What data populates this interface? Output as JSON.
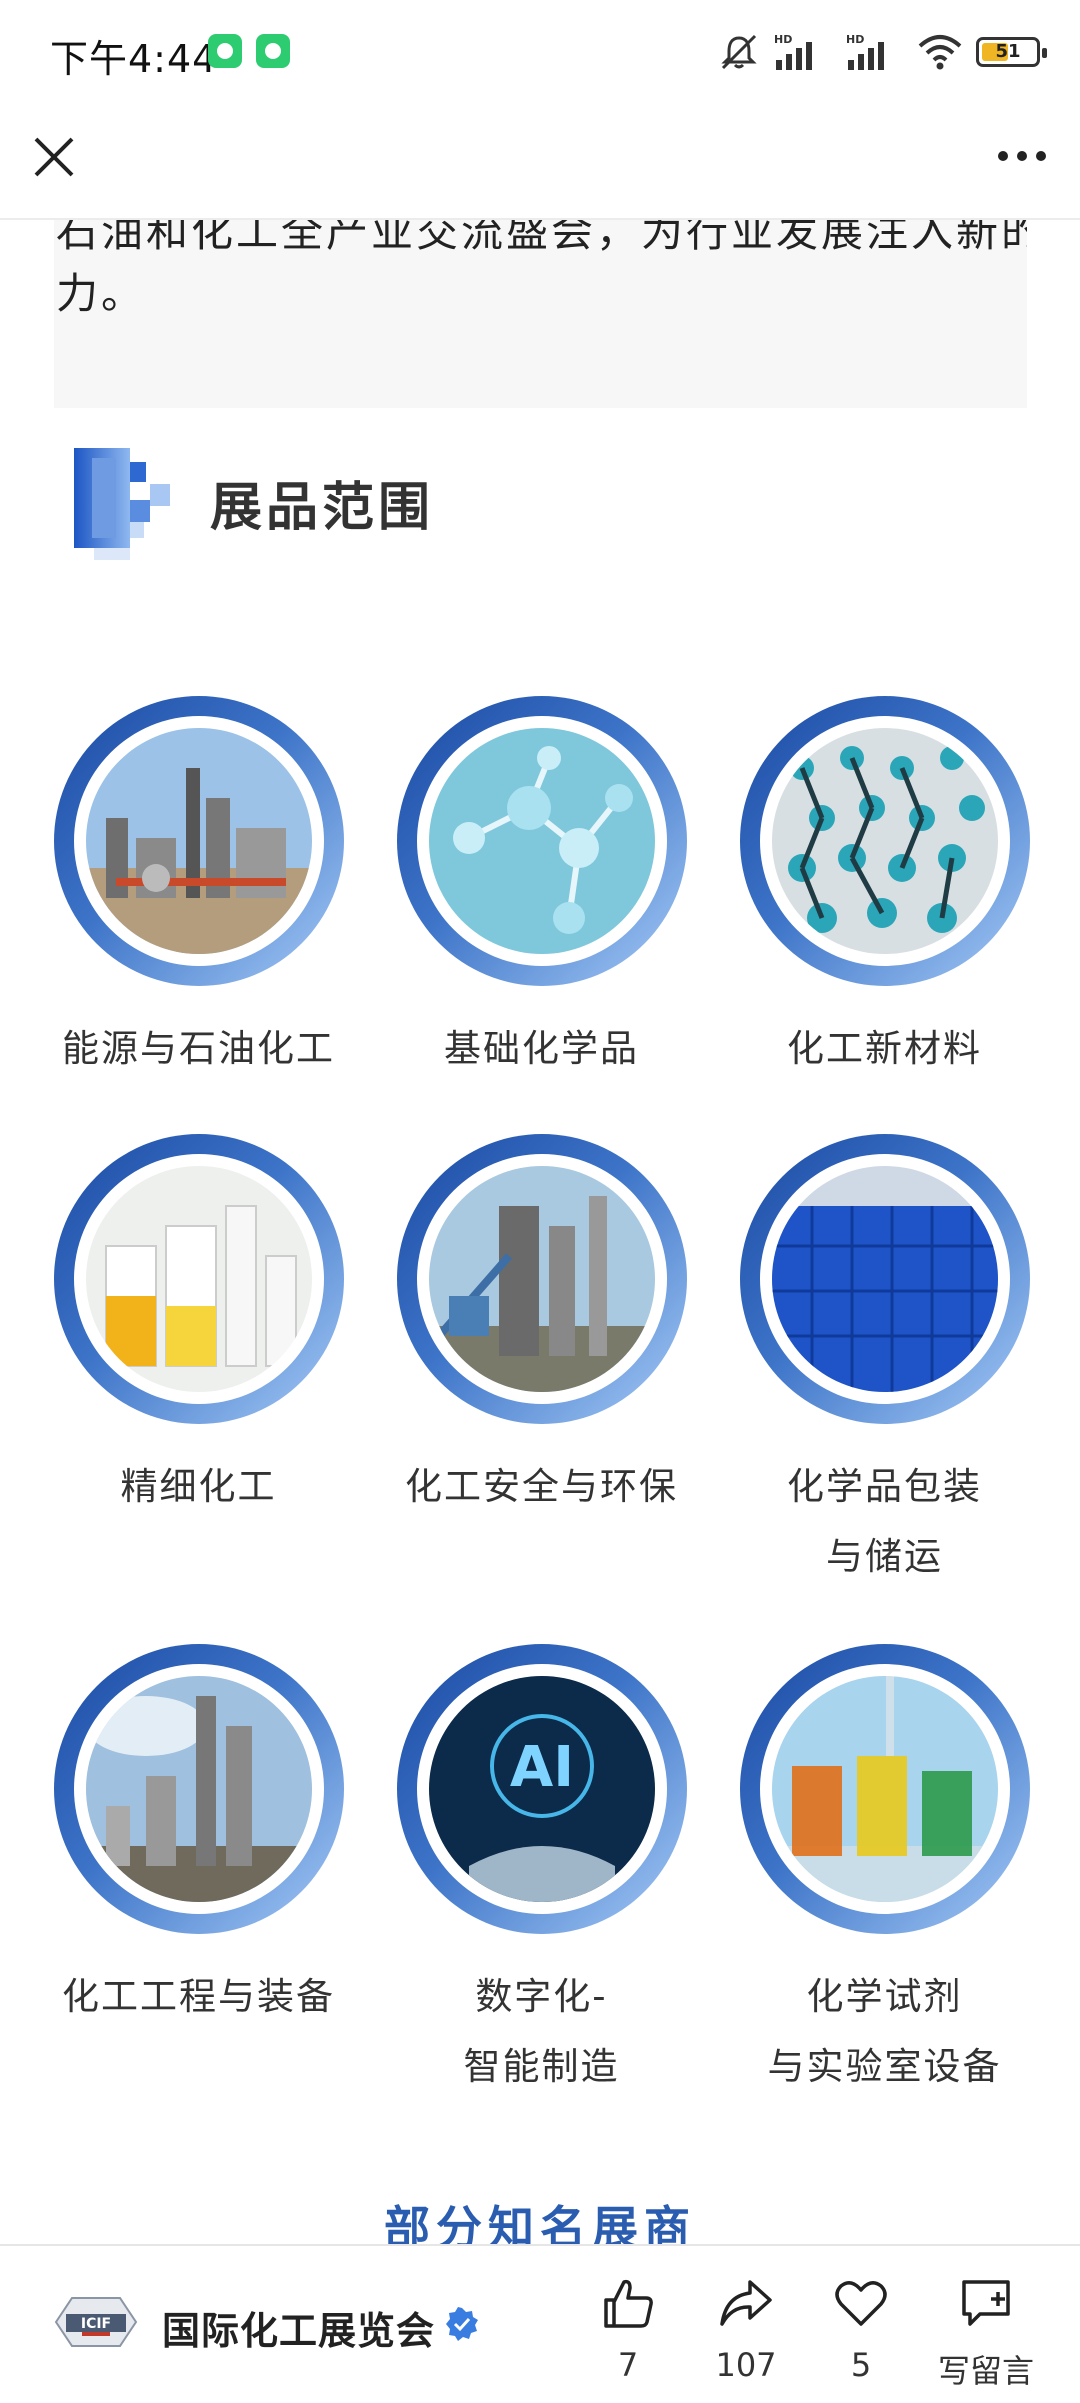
{
  "status_bar": {
    "time": "下午4:44",
    "battery": "51"
  },
  "article": {
    "quote_line1": "石油和化工全产业交流盛会，为行业发展注入新的活",
    "quote_line2": "力。",
    "section_title": "展品范围",
    "categories": [
      {
        "label": "能源与石油化工"
      },
      {
        "label": "基础化学品"
      },
      {
        "label": "化工新材料"
      },
      {
        "label": "精细化工"
      },
      {
        "label": "化工安全与环保"
      },
      {
        "label": "化学品包装",
        "label2": "与储运"
      },
      {
        "label": "化工工程与装备"
      },
      {
        "label": "数字化-",
        "label2": "智能制造"
      },
      {
        "label": "化学试剂",
        "label2": "与实验室设备"
      }
    ],
    "next_heading": "部分知名展商"
  },
  "bottom_bar": {
    "account_name": "国际化工展览会",
    "logo_text": "ICIF",
    "likes": "7",
    "shares": "107",
    "favorites": "5",
    "comment_label": "写留言"
  },
  "colors": {
    "accent_blue": "#2a5db0",
    "ring_dark": "#1b4aa3",
    "ring_light": "#a6cbf6"
  }
}
